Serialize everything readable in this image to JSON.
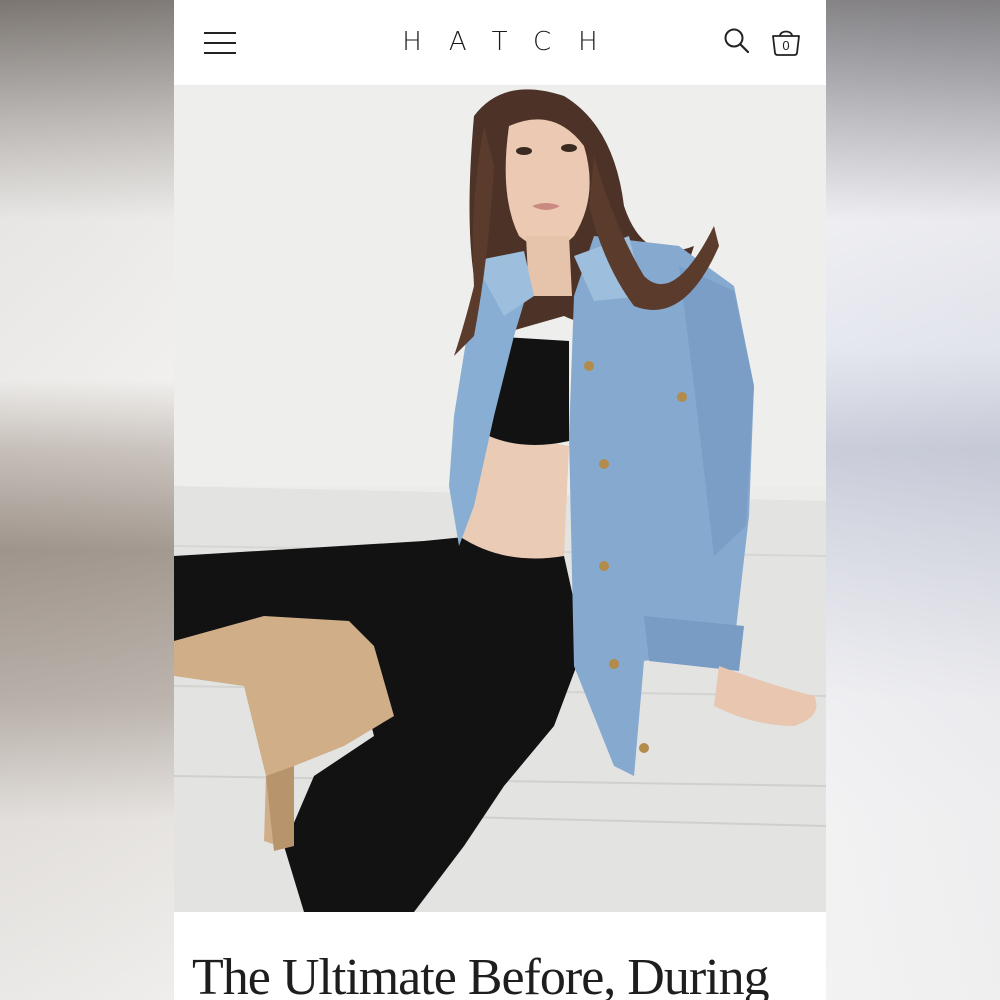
{
  "header": {
    "brand": "HATCH",
    "menu_icon": "hamburger-menu-icon",
    "search_icon": "search-icon",
    "bag_icon": "shopping-bag-icon",
    "bag_count": "0"
  },
  "hero": {
    "image": "pregnant-model-denim-jacket-photo"
  },
  "article": {
    "headline": "The Ultimate Before, During"
  },
  "colors": {
    "background": "#ffffff",
    "text": "#1e1e1e",
    "denim": "#86a9cf"
  }
}
